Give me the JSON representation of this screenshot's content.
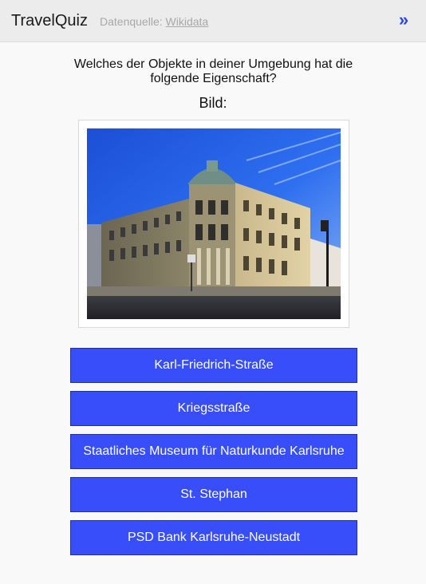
{
  "header": {
    "title": "TravelQuiz",
    "source_prefix": "Datenquelle:",
    "source_link": "Wikidata",
    "next_icon": "double-chevron-right-icon",
    "next_label": "»"
  },
  "quiz": {
    "question": "Welches der Objekte in deiner Umgebung hat die folgende Eigenschaft?",
    "property_label": "Bild:",
    "image_description_icon": "building-photo",
    "answers": [
      "Karl-Friedrich-Straße",
      "Kriegsstraße",
      "Staatliches Museum für Naturkunde Karlsruhe",
      "St. Stephan",
      "PSD Bank Karlsruhe-Neustadt"
    ]
  },
  "colors": {
    "header_bg": "#ececec",
    "accent": "#374efa",
    "accent_border": "#21319e",
    "next_arrow": "#2e45e6",
    "page_bg": "#f9f9f9"
  }
}
